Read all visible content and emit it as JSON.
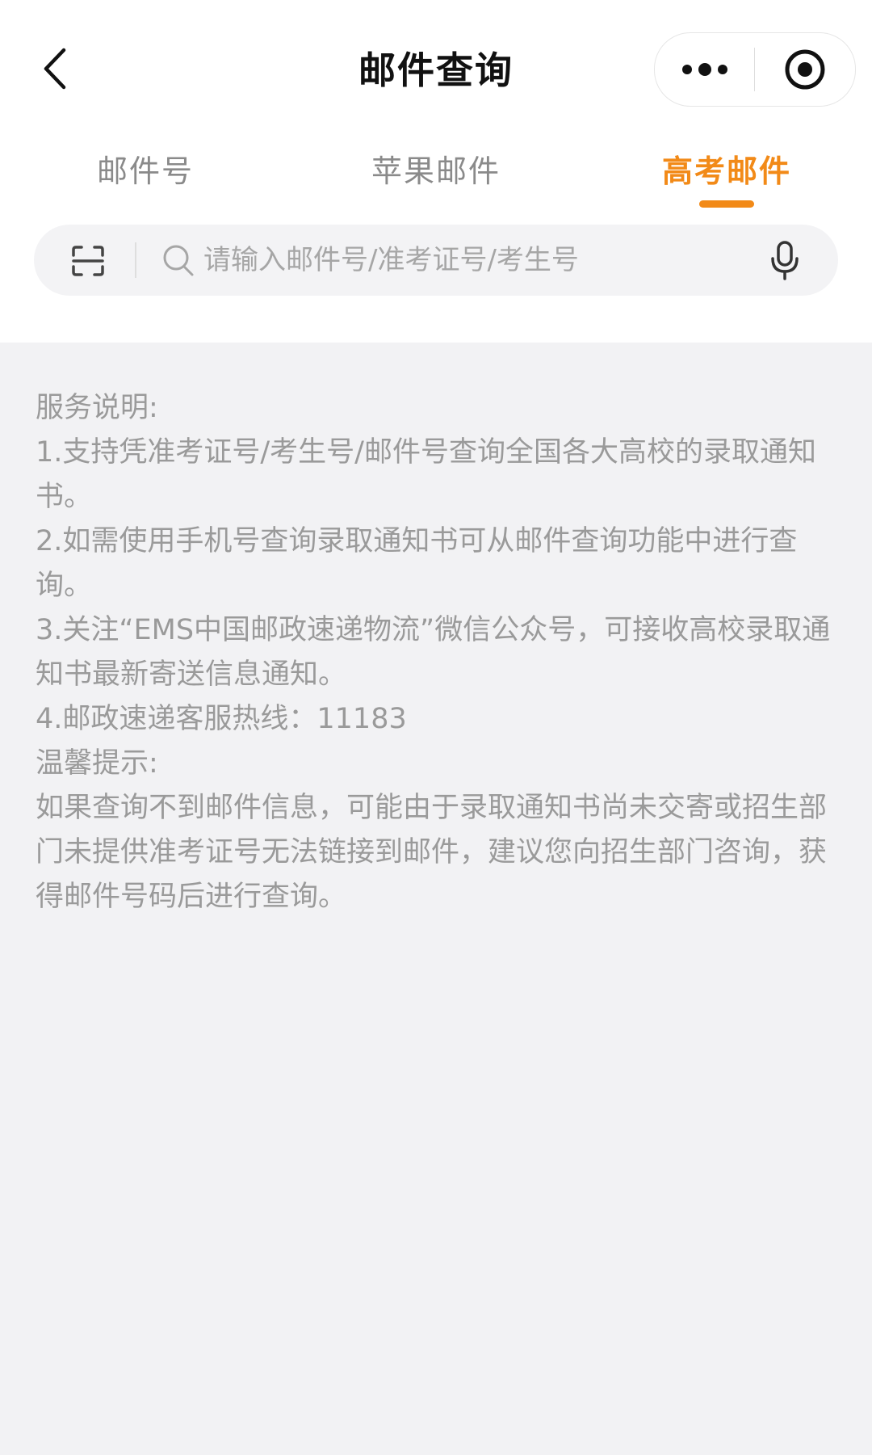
{
  "header": {
    "title": "邮件查询",
    "back_icon": "chevron-left-icon",
    "more_icon": "more-dots-icon",
    "close_icon": "target-close-icon"
  },
  "tabs": [
    {
      "label": "邮件号",
      "active": false
    },
    {
      "label": "苹果邮件",
      "active": false
    },
    {
      "label": "高考邮件",
      "active": true
    }
  ],
  "search": {
    "placeholder": "请输入邮件号/准考证号/考生号",
    "value": "",
    "scan_icon": "scan-icon",
    "search_icon": "search-icon",
    "mic_icon": "microphone-icon"
  },
  "notice": {
    "service_heading": "服务说明:",
    "items": [
      "1.支持凭准考证号/考生号/邮件号查询全国各大高校的录取通知书。",
      "2.如需使用手机号查询录取通知书可从邮件查询功能中进行查询。",
      "3.关注“EMS中国邮政速递物流”微信公众号，可接收高校录取通知书最新寄送信息通知。",
      "4.邮政速递客服热线：11183"
    ],
    "tips_heading": "温馨提示:",
    "tips_text": "如果查询不到邮件信息，可能由于录取通知书尚未交寄或招生部门未提供准考证号无法链接到邮件，建议您向招生部门咨询，获得邮件号码后进行查询。"
  },
  "colors": {
    "accent": "#f28a18",
    "tab_inactive": "#8a8a8a",
    "body_text": "#9a9a9a",
    "page_bg": "#f2f2f4"
  }
}
